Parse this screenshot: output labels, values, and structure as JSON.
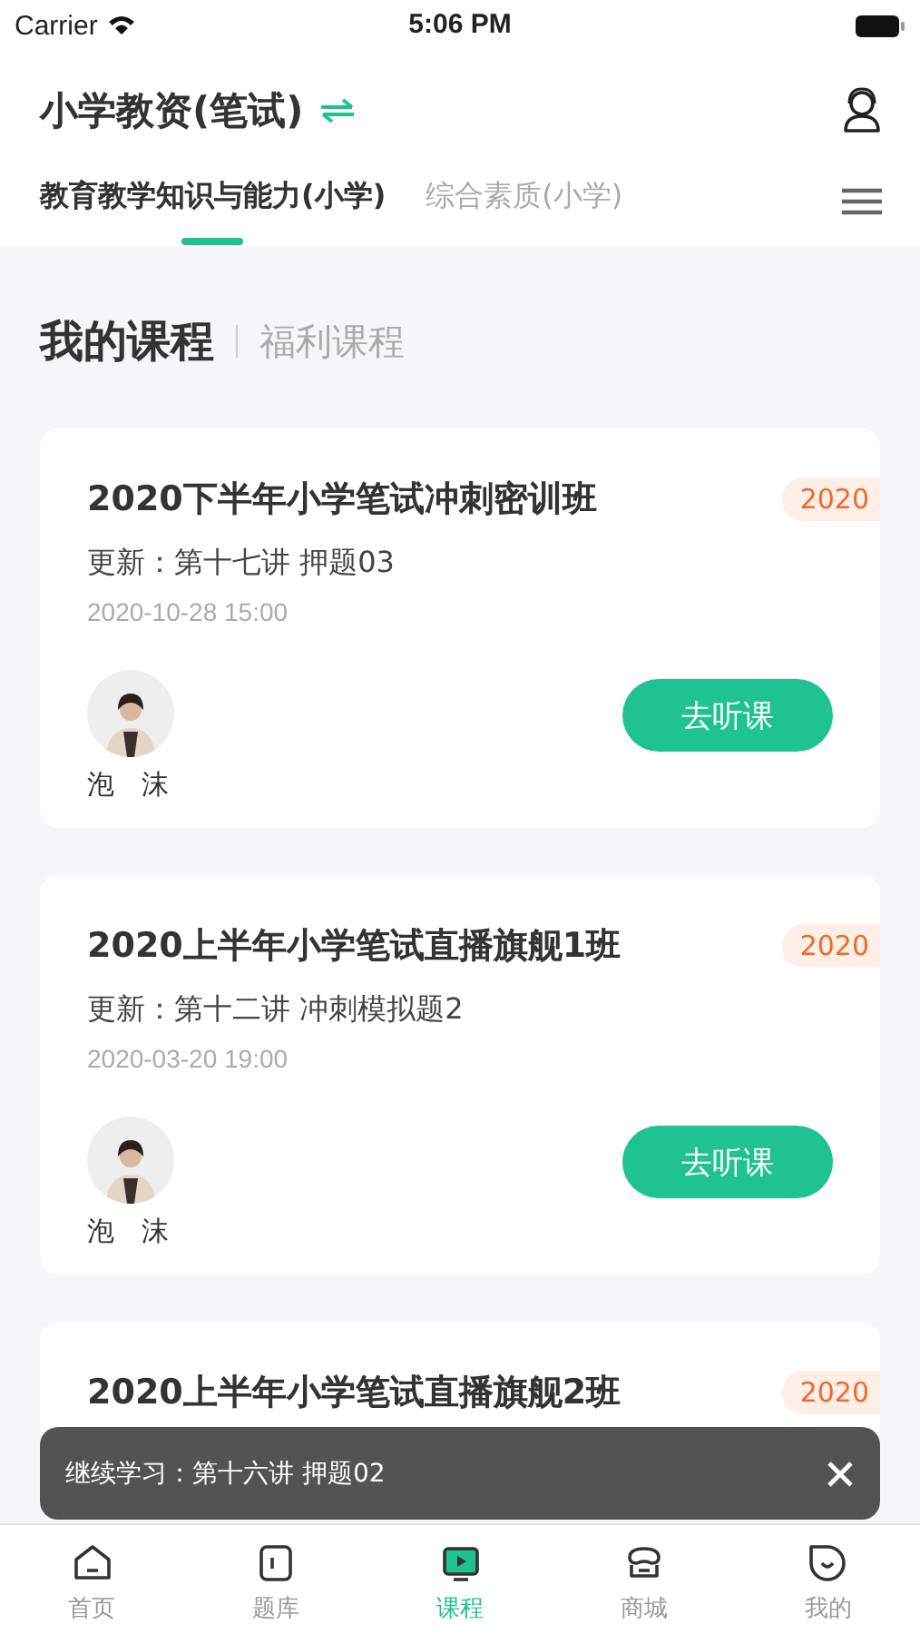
{
  "status_bar": {
    "carrier": "Carrier",
    "time": "5:06 PM"
  },
  "header": {
    "title": "小学教资(笔试)"
  },
  "tabs": [
    {
      "label": "教育教学知识与能力(小学)",
      "selected": true
    },
    {
      "label": "综合素质(小学)",
      "selected": false
    }
  ],
  "section": {
    "title": "我的课程",
    "secondary": "福利课程"
  },
  "courses": [
    {
      "title": "2020下半年小学笔试冲刺密训班",
      "badge": "2020",
      "update": "更新：第十七讲 押题03",
      "date": "2020-10-28  15:00",
      "teacher": "泡　沫",
      "action": "去听课"
    },
    {
      "title": "2020上半年小学笔试直播旗舰1班",
      "badge": "2020",
      "update": "更新：第十二讲 冲刺模拟题2",
      "date": "2020-03-20  19:00",
      "teacher": "泡　沫",
      "action": "去听课"
    },
    {
      "title": "2020上半年小学笔试直播旗舰2班",
      "badge": "2020"
    }
  ],
  "toast": {
    "text": "继续学习：第十六讲 押题02"
  },
  "tab_bar": [
    {
      "label": "首页",
      "kind": "home",
      "selected": false
    },
    {
      "label": "题库",
      "kind": "bank",
      "selected": false
    },
    {
      "label": "课程",
      "kind": "course",
      "selected": true
    },
    {
      "label": "商城",
      "kind": "shop",
      "selected": false
    },
    {
      "label": "我的",
      "kind": "me",
      "selected": false
    }
  ]
}
